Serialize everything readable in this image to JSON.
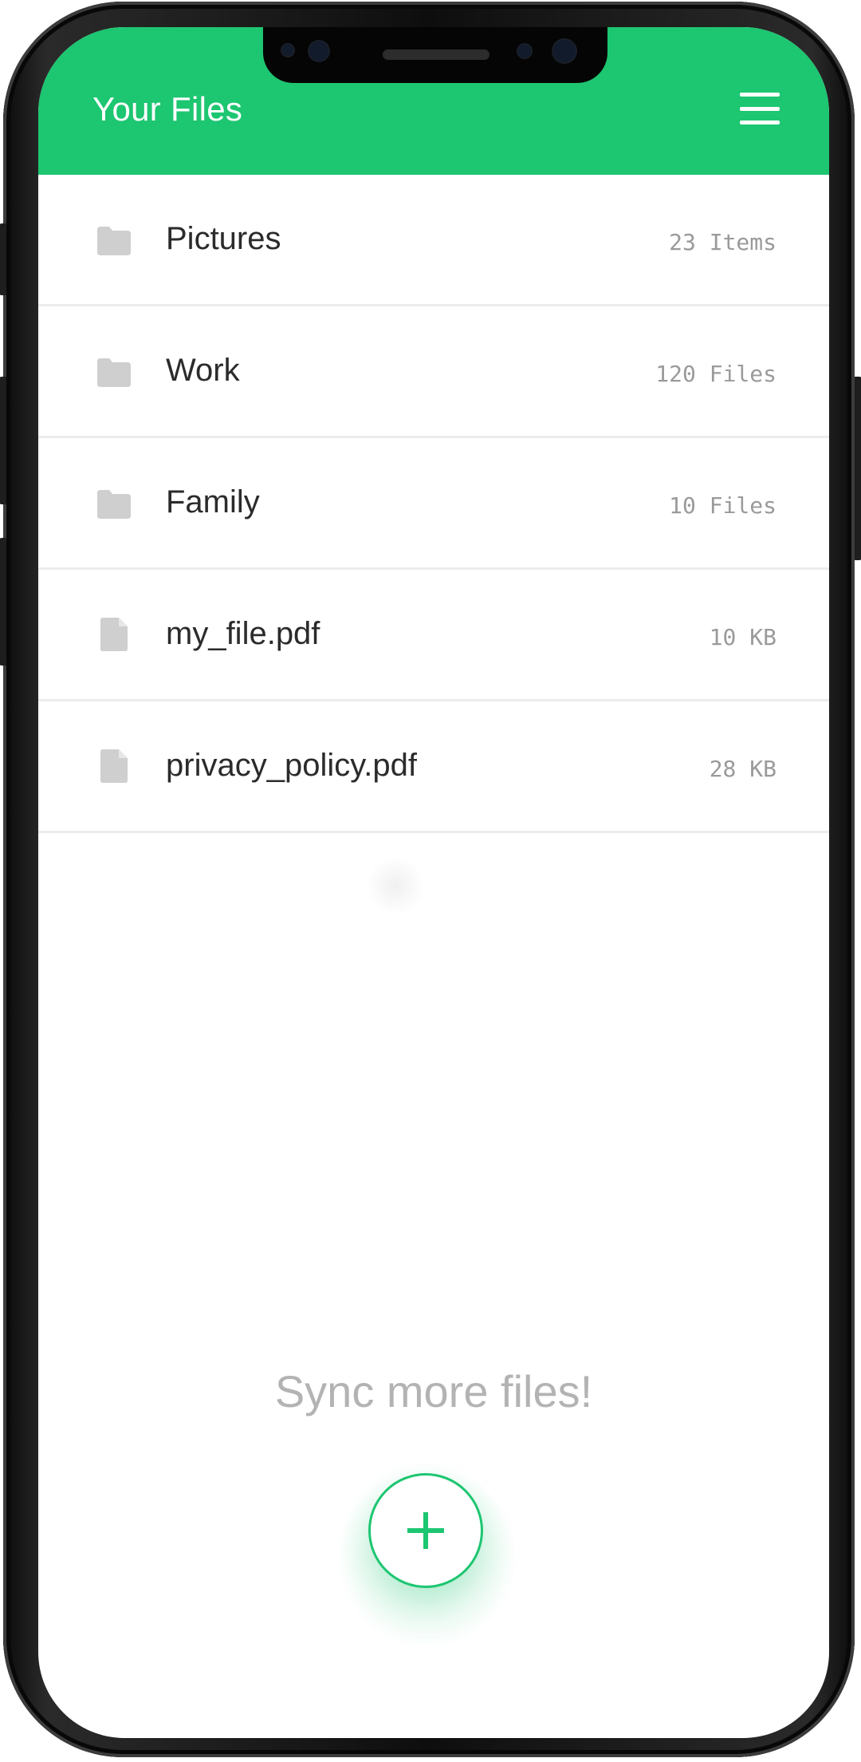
{
  "header": {
    "title": "Your Files",
    "menu_icon": "hamburger-menu-icon",
    "background_color": "#1dc671"
  },
  "files": [
    {
      "name": "Pictures",
      "meta": "23 Items",
      "type": "folder",
      "icon": "folder-icon"
    },
    {
      "name": "Work",
      "meta": "120 Files",
      "type": "folder",
      "icon": "folder-icon"
    },
    {
      "name": "Family",
      "meta": "10 Files",
      "type": "folder",
      "icon": "folder-icon"
    },
    {
      "name": "my_file.pdf",
      "meta": "10 KB",
      "type": "file",
      "icon": "file-icon"
    },
    {
      "name": "privacy_policy.pdf",
      "meta": "28 KB",
      "type": "file",
      "icon": "file-icon"
    }
  ],
  "footer": {
    "sync_text": "Sync more files!",
    "add_button_icon": "plus-icon",
    "accent_color": "#1dc671"
  }
}
